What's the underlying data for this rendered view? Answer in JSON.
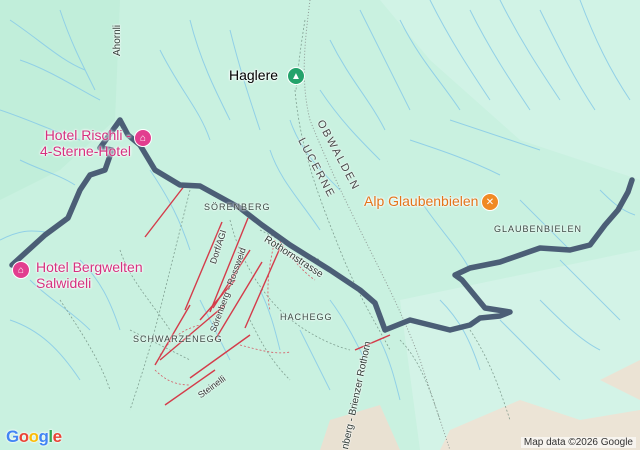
{
  "map": {
    "colors": {
      "background": "#c6f0df",
      "route": "#4b5e76",
      "poi_lodging": "#e23e8f",
      "poi_food": "#f08a24",
      "poi_peak": "#24a36b",
      "ski_run": "#d43c4a"
    },
    "pois": [
      {
        "id": "haglere",
        "label": "Haglere",
        "icon": "mountain-icon",
        "color": "#3a6b52"
      },
      {
        "id": "hotel-rischli",
        "label": "Hotel Rischli -\n4-Sterne-Hotel",
        "icon": "hotel-icon",
        "color": "#d6317f"
      },
      {
        "id": "hotel-bergwelten",
        "label": "Hotel Bergwelten\nSalwideli",
        "icon": "hotel-icon",
        "color": "#d6317f"
      },
      {
        "id": "alp-glaubenbielen",
        "label": "Alp Glaubenbielen",
        "icon": "restaurant-icon",
        "color": "#e3741b"
      }
    ],
    "places": {
      "sorenberg": "SÖRENBERG",
      "glaubenbielen": "GLAUBENBIELEN",
      "schwarzenegg": "SCHWARZENEGG",
      "hachegg": "HACHEGG"
    },
    "regions": {
      "obwalden": "OBWALDEN",
      "lucerne": "LUCERNE"
    },
    "roads": {
      "ahornli": "Ahornli",
      "rothornstrasse": "Rothornstrasse",
      "brienzer": "nberg - Brienzer Rothorn"
    },
    "slopes": {
      "dorf": "Dorf/AGI",
      "rossweid": "Sörenberg - Rossweid",
      "steinelli": "Steinelli"
    },
    "attribution": "Map data ©2026 Google",
    "logo": "Google"
  }
}
